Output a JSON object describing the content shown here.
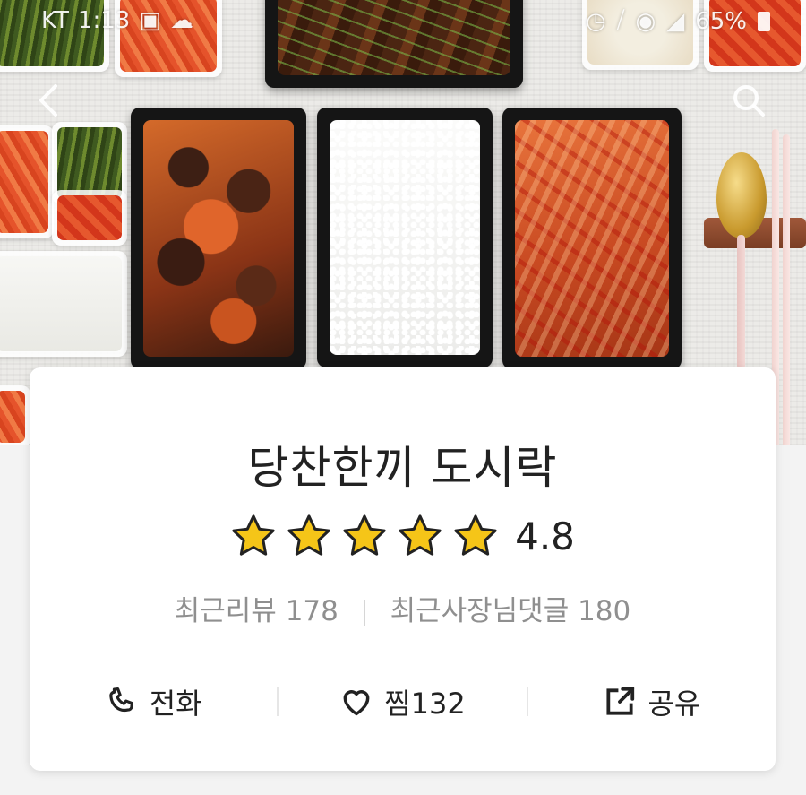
{
  "status_bar": {
    "carrier": "KT",
    "time": "1:13",
    "battery": "65%",
    "icons": [
      "image-icon",
      "cloud-icon",
      "alarm-icon",
      "mute-icon",
      "wifi-icon",
      "signal-icon",
      "battery-icon"
    ]
  },
  "nav": {
    "back_icon": "chevron-left-icon",
    "search_icon": "search-icon"
  },
  "store": {
    "name": "당찬한끼 도시락",
    "rating": "4.8",
    "stars_filled": 5,
    "stars_total": 5,
    "star_color": "#f5c518"
  },
  "reviews": {
    "recent_reviews_label": "최근리뷰",
    "recent_reviews_count": "178",
    "owner_replies_label": "최근사장님댓글",
    "owner_replies_count": "180"
  },
  "actions": {
    "call_label": "전화",
    "favorite_label": "찜",
    "favorite_count": "132",
    "share_label": "공유"
  }
}
